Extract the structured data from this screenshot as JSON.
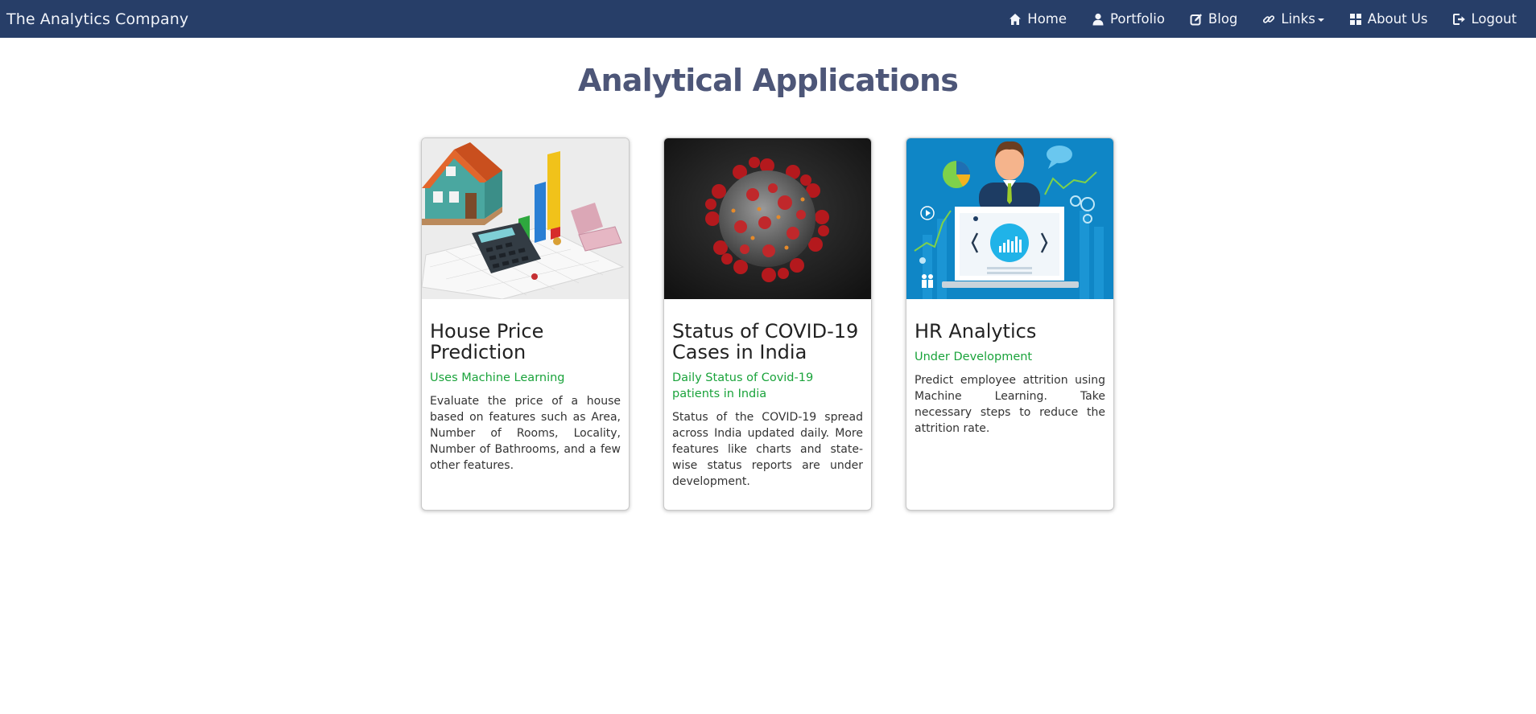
{
  "navbar": {
    "brand": "The Analytics Company",
    "items": [
      {
        "label": "Home",
        "icon": "home-icon"
      },
      {
        "label": "Portfolio",
        "icon": "user-icon"
      },
      {
        "label": "Blog",
        "icon": "edit-icon"
      },
      {
        "label": "Links",
        "icon": "link-icon",
        "dropdown": true
      },
      {
        "label": "About Us",
        "icon": "grid-icon"
      },
      {
        "label": "Logout",
        "icon": "logout-icon"
      }
    ],
    "background_color": "#273e68"
  },
  "main": {
    "title": "Analytical Applications",
    "title_color": "#4d5678",
    "cards": [
      {
        "title": "House Price Prediction",
        "subtitle": "Uses Machine Learning",
        "text": "Evaluate the price of a house based on features such as Area, Number of Rooms, Locality, Number of Bathrooms, and a few other features.",
        "image": "house-price-illustration"
      },
      {
        "title": "Status of COVID-19 Cases in India",
        "subtitle": "Daily Status of Covid-19 patients in India",
        "text": "Status of the COVID-19 spread across India updated daily. More features like charts and state-wise status reports are under development.",
        "image": "coronavirus-illustration"
      },
      {
        "title": "HR Analytics",
        "subtitle": "Under Development",
        "text": "Predict employee attrition using Machine Learning. Take necessary steps to reduce the attrition rate.",
        "image": "hr-analytics-illustration"
      }
    ],
    "subtitle_color": "#1aa33b"
  }
}
